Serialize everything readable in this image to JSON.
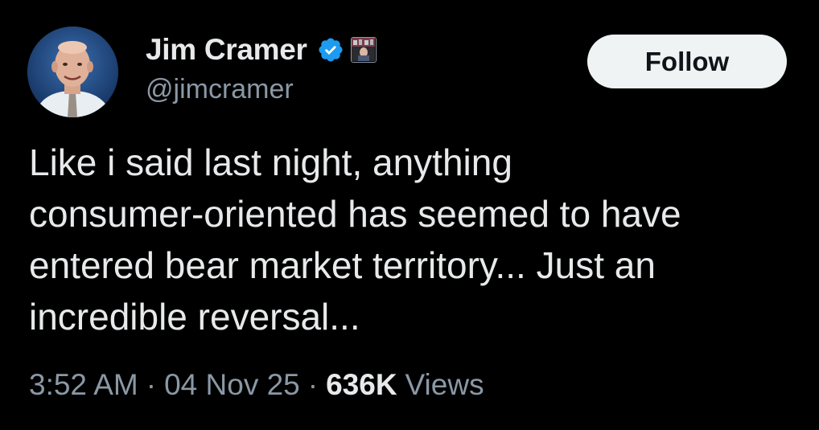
{
  "author": {
    "display_name": "Jim Cramer",
    "handle": "@jimcramer",
    "verified_icon": "verified-badge-icon",
    "affiliate_icon": "affiliate-badge-icon",
    "accent_color": "#1d9bf0"
  },
  "follow_button": {
    "label": "Follow"
  },
  "tweet": {
    "text_lines": [
      "Like i said last night, anything",
      "consumer-oriented has seemed to have",
      "entered bear market territory... Just an",
      "incredible reversal..."
    ]
  },
  "meta": {
    "time": "3:52 AM",
    "separator": "·",
    "date": "04 Nov 25",
    "views_count": "636K",
    "views_label": "Views"
  }
}
